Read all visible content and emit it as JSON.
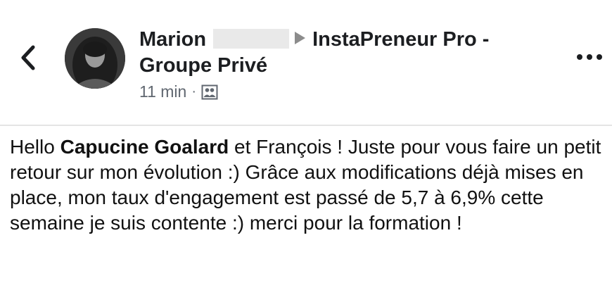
{
  "header": {
    "author_name": "Marion",
    "group_name": "InstaPreneur Pro - Groupe Privé",
    "time": "11 min",
    "separator": "·",
    "audience_icon": "group-audience-icon",
    "back_icon": "chevron-left-icon",
    "more_icon": "more-dots-icon"
  },
  "post": {
    "greeting": "Hello",
    "mention": "Capucine Goalard",
    "body": "et François ! Juste pour vous faire un petit retour sur mon évolution :) Grâce aux modifications déjà mises en place, mon taux d'engagement est passé de 5,7 à 6,9% cette semaine je suis contente :) merci pour la formation !"
  },
  "colors": {
    "text": "#1c1e21",
    "meta": "#606770",
    "divider": "#e4e4e4",
    "redaction": "#e9e9e9"
  }
}
